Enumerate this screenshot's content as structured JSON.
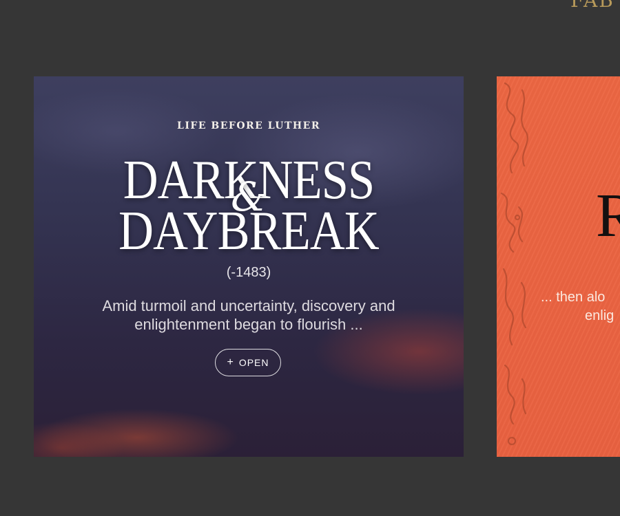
{
  "page": {
    "top_partial_text": "FAB"
  },
  "cards": [
    {
      "kicker": "LIFE BEFORE LUTHER",
      "title_line1": "DARKNESS",
      "title_amp": "&",
      "title_line2": "DAYBREAK",
      "years": "(-1483)",
      "description": "Amid turmoil and uncertainty, discovery and enlightenment began to flourish ...",
      "open_icon": "+",
      "open_label": "OPEN"
    },
    {
      "title_initial": "R",
      "description_line1": "... then alo",
      "description_line2": "enlig"
    }
  ],
  "colors": {
    "background": "#363636",
    "accent_gold": "#b89a5a",
    "orange_card": "#ec6642"
  }
}
